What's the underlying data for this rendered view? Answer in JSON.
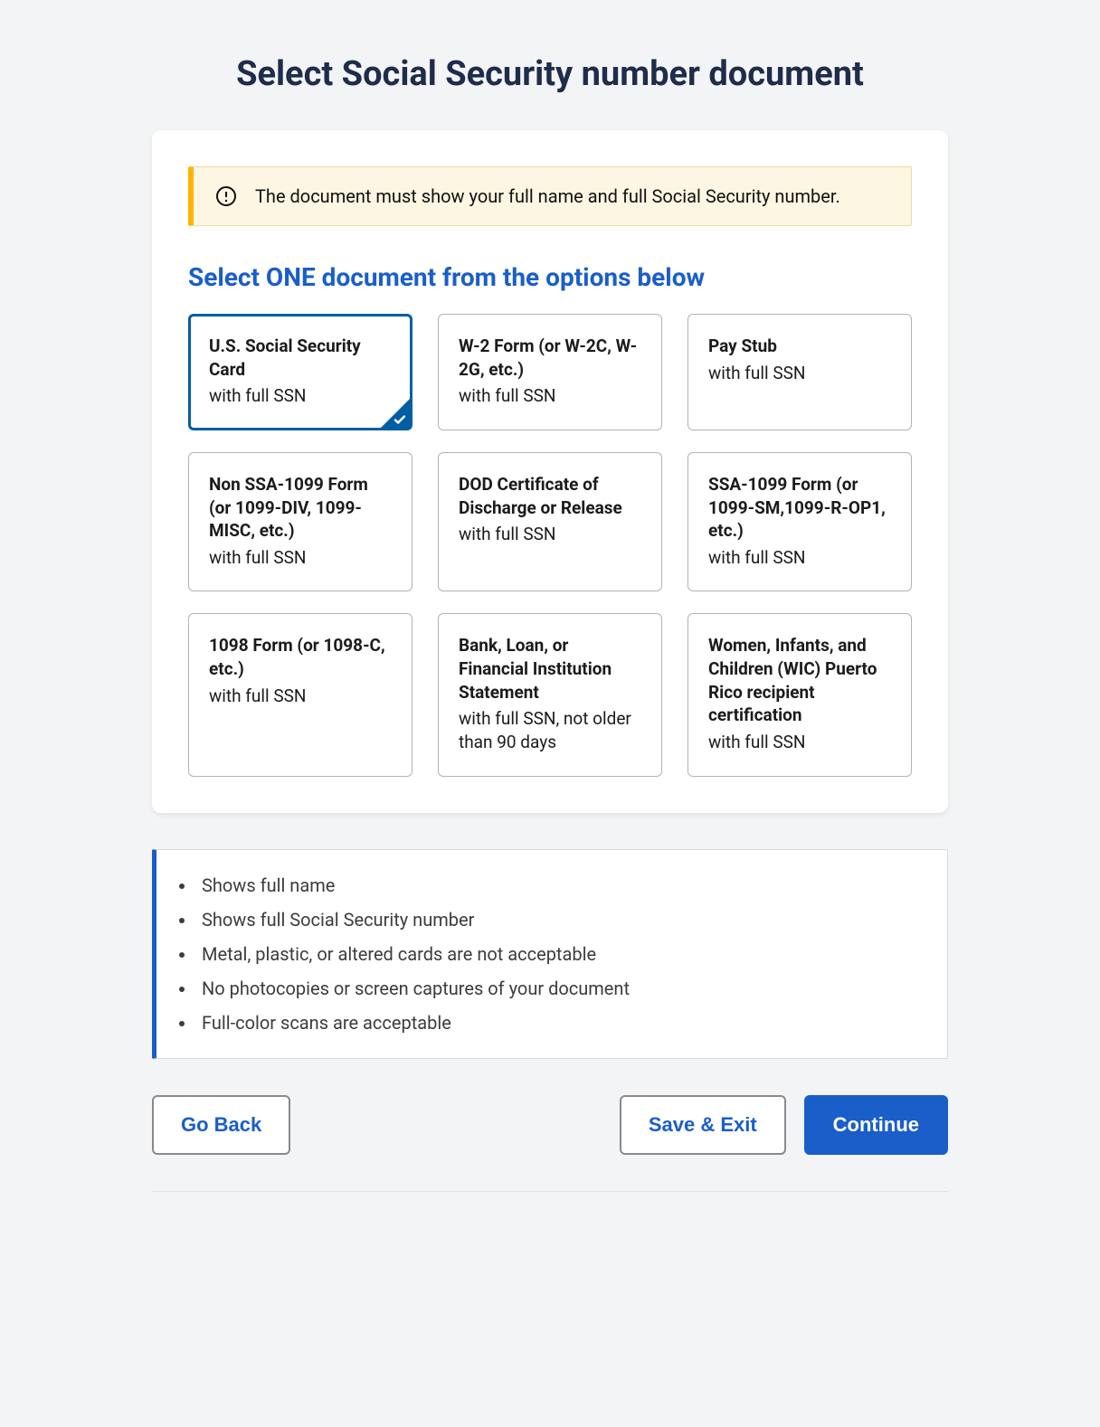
{
  "page_title": "Select Social Security number document",
  "alert": {
    "text": "The document must show your full name and full Social Security number."
  },
  "section_heading": "Select ONE document from the options below",
  "tiles": [
    {
      "title": "U.S. Social Security Card",
      "sub": "with full SSN",
      "selected": true
    },
    {
      "title": "W-2 Form (or W-2C, W-2G, etc.)",
      "sub": "with full SSN",
      "selected": false
    },
    {
      "title": "Pay Stub",
      "sub": "with full SSN",
      "selected": false
    },
    {
      "title": "Non SSA-1099 Form (or 1099-DIV, 1099-MISC, etc.)",
      "sub": "with full SSN",
      "selected": false
    },
    {
      "title": "DOD Certificate of Discharge or Release",
      "sub": "with full SSN",
      "selected": false
    },
    {
      "title": "SSA-1099 Form (or 1099-SM,1099-R-OP1, etc.)",
      "sub": "with full SSN",
      "selected": false
    },
    {
      "title": "1098 Form (or 1098-C, etc.)",
      "sub": "with full SSN",
      "selected": false
    },
    {
      "title": "Bank, Loan, or Financial Institution Statement",
      "sub": "with full SSN, not older than 90 days",
      "selected": false
    },
    {
      "title": "Women, Infants, and Children (WIC) Puerto Rico recipient certification",
      "sub": "with full SSN",
      "selected": false
    }
  ],
  "requirements": [
    "Shows full name",
    "Shows full Social Security number",
    "Metal, plastic, or altered cards are not acceptable",
    "No photocopies or screen captures of your document",
    "Full-color scans are acceptable"
  ],
  "buttons": {
    "go_back": "Go Back",
    "save_exit": "Save & Exit",
    "continue": "Continue"
  }
}
